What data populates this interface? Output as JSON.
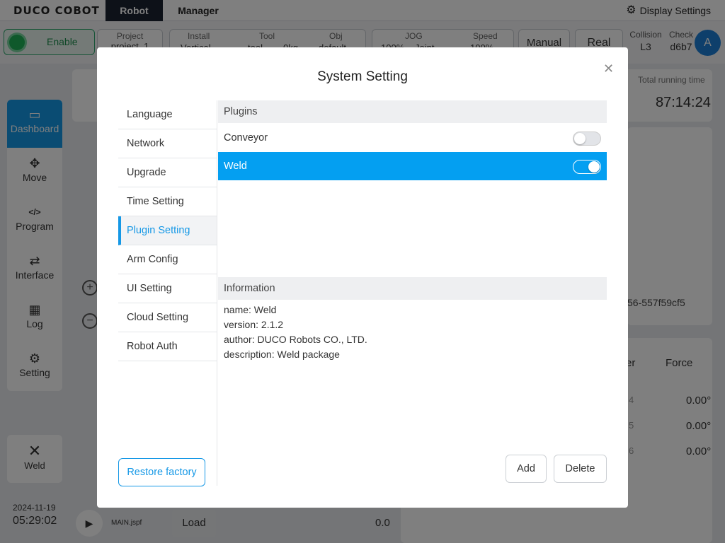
{
  "topbar": {
    "logo": "DUCO COBOT",
    "tabs": [
      "Robot",
      "Manager"
    ],
    "display_settings": "Display Settings",
    "gear_icon": "gear-icon"
  },
  "statusbar": {
    "enable": "Enable",
    "project": {
      "label": "Project",
      "value": "project_1"
    },
    "install": {
      "label": "Install",
      "value": "Vertical"
    },
    "tool": {
      "label": "Tool",
      "value": "tool"
    },
    "tool_load": "0kg",
    "obj": {
      "label": "Obj",
      "value": "default"
    },
    "jog": {
      "label": "JOG",
      "value": "100%"
    },
    "jog_mode": "Joint",
    "speed": {
      "label": "Speed",
      "value": "100%"
    },
    "manual": "Manual",
    "real": "Real",
    "collision": {
      "label": "Collision",
      "value": "L3"
    },
    "check": {
      "label": "Check",
      "value": "d6b7"
    },
    "avatar": "A"
  },
  "leftnav": {
    "items": [
      {
        "label": "Dashboard",
        "icon": "monitor-icon"
      },
      {
        "label": "Move",
        "icon": "move-arrows-icon"
      },
      {
        "label": "Program",
        "icon": "code-icon"
      },
      {
        "label": "Interface",
        "icon": "swap-icon"
      },
      {
        "label": "Log",
        "icon": "calendar-icon"
      },
      {
        "label": "Setting",
        "icon": "gear-icon"
      }
    ],
    "weld": "Weld"
  },
  "datetime": {
    "date": "2024-11-19",
    "time": "05:29:02"
  },
  "background": {
    "total_running_label": "Total running time",
    "total_running_value": "87:14:24",
    "hash": "56-557f59cf5",
    "er": "er",
    "force": "Force",
    "joint_nums": [
      "4",
      "5",
      "6"
    ],
    "joint_values": [
      "0.00°",
      "0.00°",
      "0.00°"
    ],
    "program_file": "MAIN.jspf",
    "load": "Load",
    "zero": "0.0"
  },
  "modal": {
    "title": "System Setting",
    "menu": [
      "Language",
      "Network",
      "Upgrade",
      "Time Setting",
      "Plugin Setting",
      "Arm Config",
      "UI Setting",
      "Cloud Setting",
      "Robot Auth"
    ],
    "active_menu": "Plugin Setting",
    "plugins_header": "Plugins",
    "plugins": [
      {
        "name": "Conveyor",
        "enabled": false
      },
      {
        "name": "Weld",
        "enabled": true
      }
    ],
    "information_header": "Information",
    "information": [
      "name: Weld",
      "version: 2.1.2",
      "author: DUCO Robots CO., LTD.",
      "description: Weld package"
    ],
    "restore_factory": "Restore factory",
    "add": "Add",
    "delete": "Delete",
    "accent_color": "#049ff1"
  }
}
